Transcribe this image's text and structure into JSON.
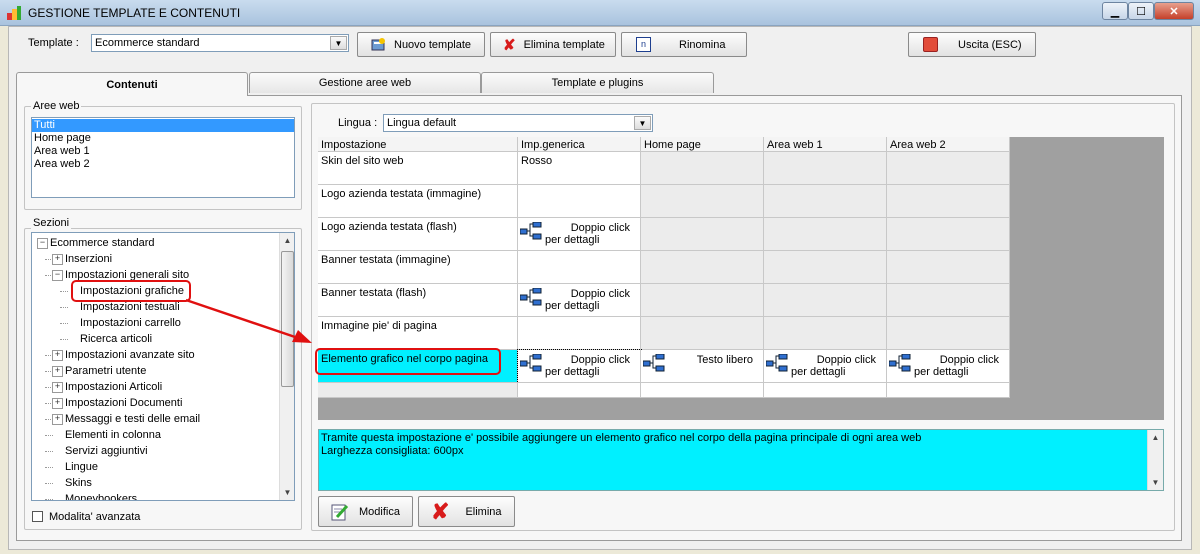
{
  "window": {
    "title": "GESTIONE TEMPLATE E CONTENUTI"
  },
  "toolbar": {
    "template_label": "Template :",
    "template_value": "Ecommerce standard",
    "new_template": "Nuovo template",
    "delete_template": "Elimina template",
    "rename": "Rinomina",
    "exit": "Uscita (ESC)"
  },
  "tabs": [
    {
      "label": "Contenuti",
      "active": true
    },
    {
      "label": "Gestione aree web",
      "active": false
    },
    {
      "label": "Template e plugins",
      "active": false
    }
  ],
  "aree_web": {
    "title": "Aree web",
    "items": [
      "Tutti",
      "Home page",
      "Area web 1",
      "Area web 2"
    ],
    "selected": "Tutti"
  },
  "sezioni": {
    "title": "Sezioni",
    "tree": [
      {
        "label": "Ecommerce standard",
        "level": 0,
        "expander": "−"
      },
      {
        "label": "Inserzioni",
        "level": 1,
        "expander": "+"
      },
      {
        "label": "Impostazioni generali sito",
        "level": 1,
        "expander": "−"
      },
      {
        "label": "Impostazioni grafiche",
        "level": 2,
        "expander": ""
      },
      {
        "label": "Impostazioni testuali",
        "level": 2,
        "expander": ""
      },
      {
        "label": "Impostazioni carrello",
        "level": 2,
        "expander": ""
      },
      {
        "label": "Ricerca articoli",
        "level": 2,
        "expander": ""
      },
      {
        "label": "Impostazioni avanzate sito",
        "level": 1,
        "expander": "+"
      },
      {
        "label": "Parametri utente",
        "level": 1,
        "expander": "+"
      },
      {
        "label": "Impostazioni Articoli",
        "level": 1,
        "expander": "+"
      },
      {
        "label": "Impostazioni Documenti",
        "level": 1,
        "expander": "+"
      },
      {
        "label": "Messaggi e testi delle email",
        "level": 1,
        "expander": "+"
      },
      {
        "label": "Elementi in colonna",
        "level": 1,
        "expander": ""
      },
      {
        "label": "Servizi aggiuntivi",
        "level": 1,
        "expander": ""
      },
      {
        "label": "Lingue",
        "level": 1,
        "expander": ""
      },
      {
        "label": "Skins",
        "level": 1,
        "expander": ""
      },
      {
        "label": "Moneybookers",
        "level": 1,
        "expander": ""
      }
    ],
    "highlighted": "Impostazioni grafiche"
  },
  "advanced_mode": {
    "label": "Modalita' avanzata",
    "checked": false
  },
  "lingua": {
    "label": "Lingua :",
    "value": "Lingua default"
  },
  "grid": {
    "columns": [
      "Impostazione",
      "Imp.generica",
      "Home page",
      "Area web 1",
      "Area web 2"
    ],
    "rows": [
      {
        "name": "Skin del sito web",
        "cells": [
          {
            "t": "text",
            "v": "Rosso"
          },
          {
            "t": "empty"
          },
          {
            "t": "empty"
          },
          {
            "t": "empty"
          }
        ]
      },
      {
        "name": "Logo azienda testata (immagine)",
        "cells": [
          {
            "t": "empty-white"
          },
          {
            "t": "empty"
          },
          {
            "t": "empty"
          },
          {
            "t": "empty"
          }
        ]
      },
      {
        "name": "Logo azienda testata (flash)",
        "cells": [
          {
            "t": "link",
            "a": "Doppio click",
            "b": "per dettagli"
          },
          {
            "t": "empty"
          },
          {
            "t": "empty"
          },
          {
            "t": "empty"
          }
        ]
      },
      {
        "name": "Banner testata (immagine)",
        "cells": [
          {
            "t": "empty-white"
          },
          {
            "t": "empty"
          },
          {
            "t": "empty"
          },
          {
            "t": "empty"
          }
        ]
      },
      {
        "name": "Banner testata (flash)",
        "cells": [
          {
            "t": "link",
            "a": "Doppio click",
            "b": "per dettagli"
          },
          {
            "t": "empty"
          },
          {
            "t": "empty"
          },
          {
            "t": "empty"
          }
        ]
      },
      {
        "name": "Immagine pie' di pagina",
        "cells": [
          {
            "t": "empty-white"
          },
          {
            "t": "empty"
          },
          {
            "t": "empty"
          },
          {
            "t": "empty"
          }
        ]
      },
      {
        "name": "Elemento grafico nel corpo pagina",
        "selected": true,
        "cells": [
          {
            "t": "link",
            "a": "Doppio click",
            "b": "per dettagli"
          },
          {
            "t": "link",
            "a": "Testo libero",
            "b": ""
          },
          {
            "t": "link",
            "a": "Doppio click",
            "b": "per dettagli"
          },
          {
            "t": "link",
            "a": "Doppio click",
            "b": "per dettagli"
          }
        ]
      }
    ]
  },
  "description": {
    "line1": "Tramite questa impostazione e' possibile aggiungere un elemento grafico nel corpo della pagina principale di ogni area web",
    "line2": "Larghezza consigliata: 600px"
  },
  "actions": {
    "modify": "Modifica",
    "delete": "Elimina"
  },
  "colors": {
    "selection_cyan": "#00f0ff",
    "list_selection": "#3399ff",
    "annotation_red": "#e01010"
  }
}
